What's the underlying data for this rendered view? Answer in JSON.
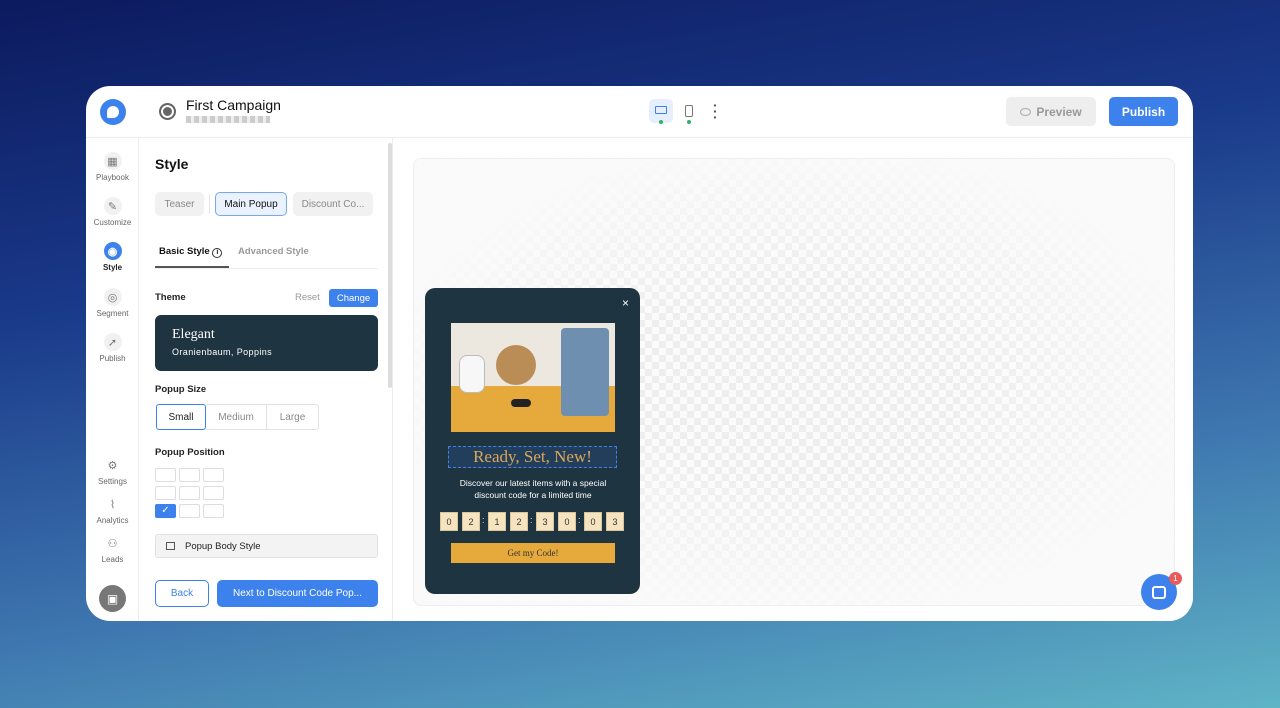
{
  "header": {
    "title": "First Campaign",
    "preview_label": "Preview",
    "publish_label": "Publish"
  },
  "rail": {
    "items": [
      {
        "label": "Playbook",
        "icon": "grid-icon"
      },
      {
        "label": "Customize",
        "icon": "pencil-icon"
      },
      {
        "label": "Style",
        "icon": "palette-icon",
        "active": true
      },
      {
        "label": "Segment",
        "icon": "target-icon"
      },
      {
        "label": "Publish",
        "icon": "rocket-icon"
      },
      {
        "label": "Settings",
        "icon": "gear-icon"
      },
      {
        "label": "Analytics",
        "icon": "chart-icon"
      },
      {
        "label": "Leads",
        "icon": "users-icon"
      }
    ]
  },
  "panel": {
    "title": "Style",
    "step_tabs": [
      "Teaser",
      "Main Popup",
      "Discount Co..."
    ],
    "style_tabs": [
      "Basic Style",
      "Advanced Style"
    ],
    "theme": {
      "label": "Theme",
      "reset": "Reset",
      "change": "Change",
      "name": "Elegant",
      "fonts": "Oranienbaum, Poppins"
    },
    "size": {
      "label": "Popup Size",
      "options": [
        "Small",
        "Medium",
        "Large"
      ],
      "selected": "Small"
    },
    "position": {
      "label": "Popup Position",
      "selected": "bottom-left"
    },
    "body_style": "Popup Body Style",
    "back": "Back",
    "next": "Next to Discount Code Pop..."
  },
  "popup": {
    "close": "×",
    "headline": "Ready, Set, New!",
    "text": "Discover our latest items with a special discount code for a limited time",
    "countdown": [
      "0",
      "2",
      "1",
      "2",
      "3",
      "0",
      "0",
      "3"
    ],
    "cta": "Get my Code!"
  },
  "chat": {
    "badge": "1"
  },
  "colors": {
    "accent": "#3d82ec",
    "popup_bg": "#1f3441",
    "cta": "#e6a93c",
    "headline": "#d9a85a"
  }
}
